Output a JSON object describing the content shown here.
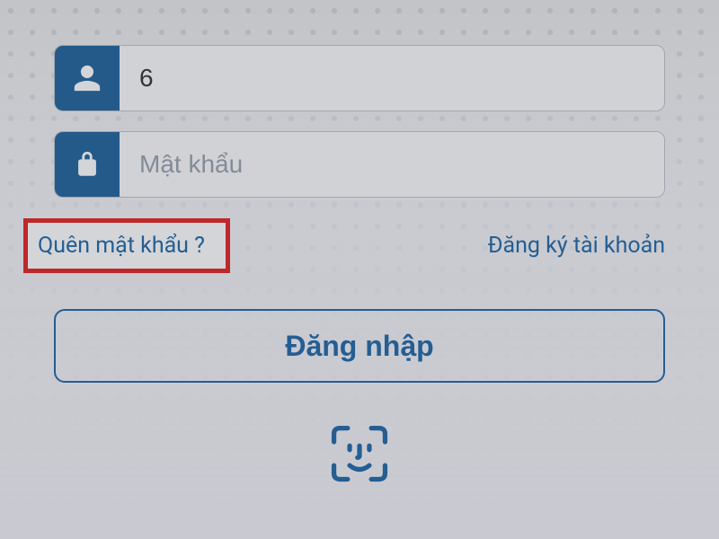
{
  "login": {
    "username_value": "6",
    "password_placeholder": "Mật khẩu",
    "forgot_password_label": "Quên mật khẩu ?",
    "register_label": "Đăng ký tài khoản",
    "login_button_label": "Đăng nhập"
  },
  "colors": {
    "primary": "#0c5aa0",
    "highlight_border": "#e11010"
  }
}
